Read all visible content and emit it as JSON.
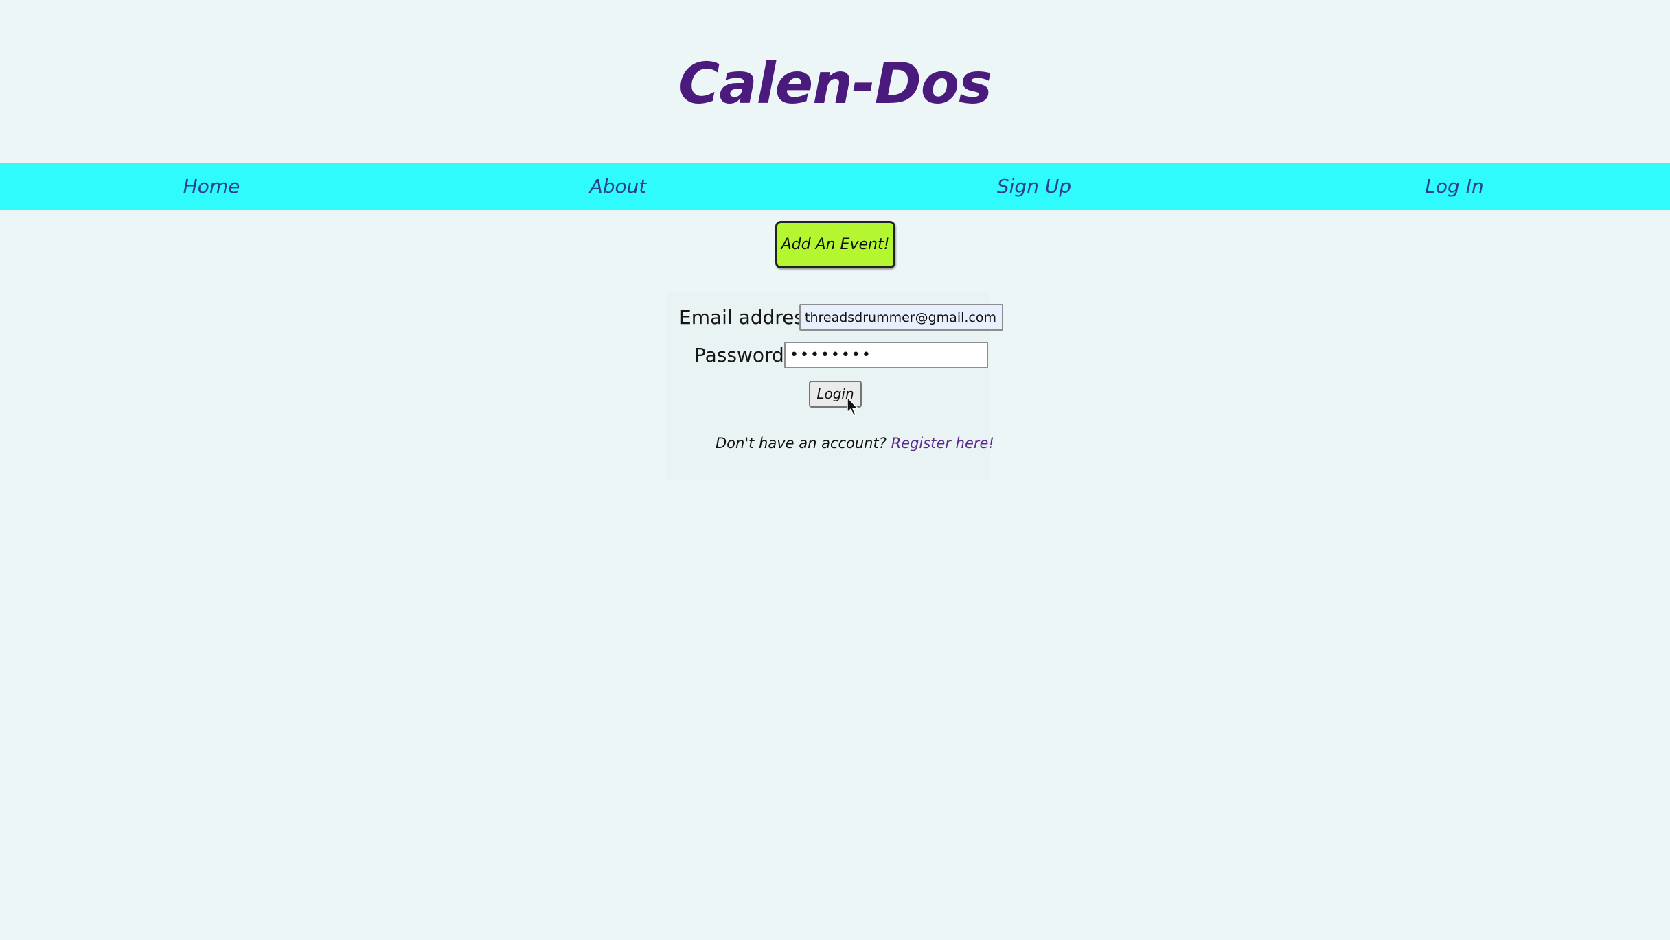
{
  "header": {
    "title": "Calen-Dos"
  },
  "nav": {
    "items": [
      {
        "label": "Home"
      },
      {
        "label": "About"
      },
      {
        "label": "Sign Up"
      },
      {
        "label": "Log In"
      }
    ]
  },
  "add_event_button": {
    "label": "Add An Event!"
  },
  "login_form": {
    "email_label": "Email address:",
    "email_value": "threadsdrummer@gmail.com",
    "password_label": "Password:",
    "password_value": "••••••••",
    "submit_label": "Login",
    "register_prompt": "Don't have an account?",
    "register_link": "Register here!"
  },
  "colors": {
    "page_background": "#edf6f7",
    "title": "#4b1a7d",
    "nav_background": "#2ffafc",
    "nav_text": "#2a3f8f",
    "add_event_background": "#b4f731",
    "register_link": "#5a2a8d"
  },
  "icons": {
    "cursor": "mouse-pointer-icon"
  }
}
